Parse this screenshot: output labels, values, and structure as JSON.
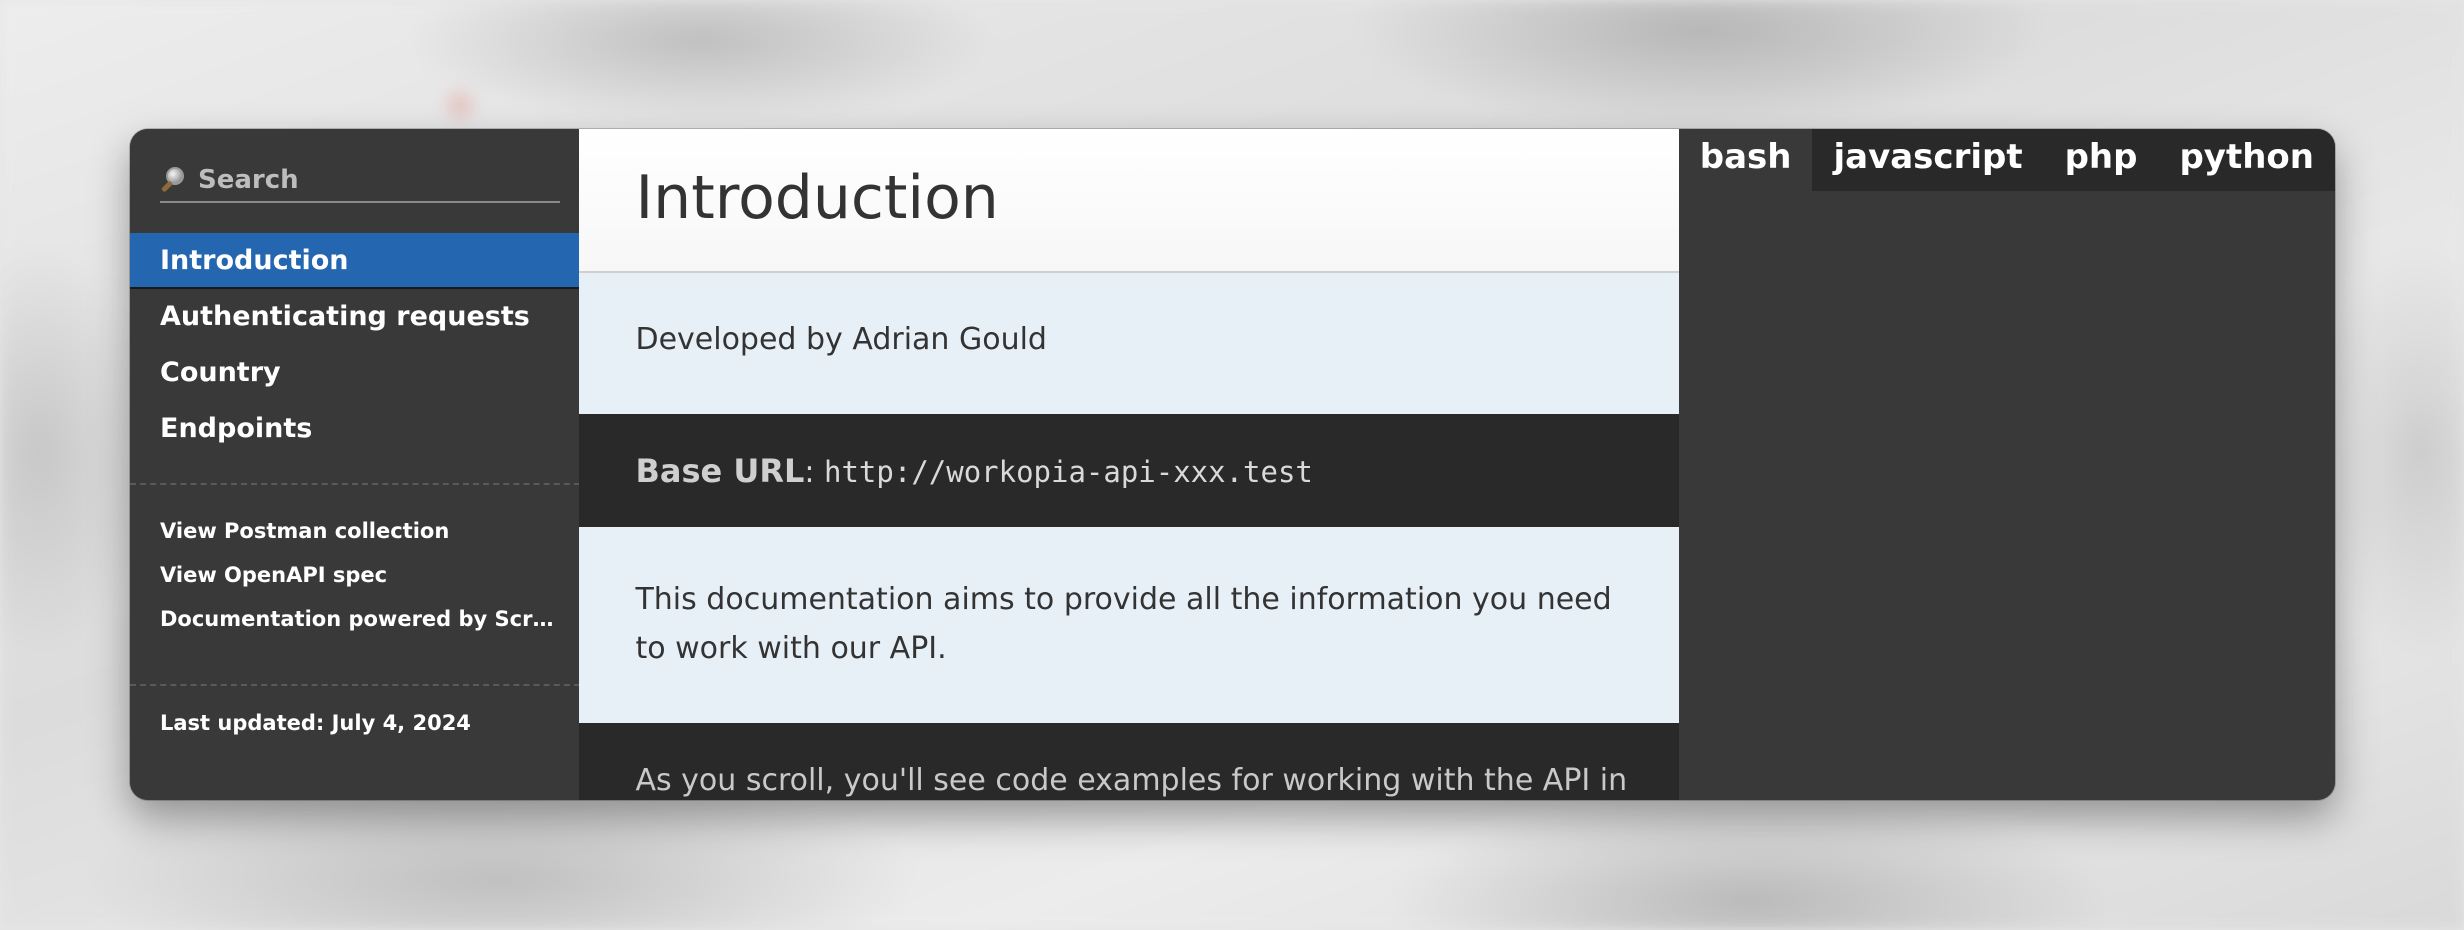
{
  "sidebar": {
    "search_placeholder": "Search",
    "nav_items": [
      {
        "label": "Introduction",
        "active": true
      },
      {
        "label": "Authenticating requests",
        "active": false
      },
      {
        "label": "Country",
        "active": false
      },
      {
        "label": "Endpoints",
        "active": false
      }
    ],
    "links": [
      {
        "label": "View Postman collection"
      },
      {
        "label": "View OpenAPI spec"
      },
      {
        "label": "Documentation powered by Scri…"
      }
    ],
    "last_updated": "Last updated: July 4, 2024"
  },
  "main": {
    "title": "Introduction",
    "developed_by": "Developed by Adrian Gould",
    "base_url_label": "Base URL",
    "base_url_sep": ": ",
    "base_url": "http://workopia-api-xxx.test",
    "intro_text": "This documentation aims to provide all the information you need to work with our API.",
    "scroll_text": "As you scroll, you'll see code examples for working with the API in"
  },
  "code_tabs": [
    {
      "label": "bash",
      "active": true
    },
    {
      "label": "javascript",
      "active": false
    },
    {
      "label": "php",
      "active": false
    },
    {
      "label": "python",
      "active": false
    }
  ],
  "colors": {
    "sidebar_bg": "#393939",
    "active_nav": "#2467b0",
    "light_block": "#e8f0f7",
    "dark_block": "#292929"
  },
  "icons": {
    "search": "search-icon"
  }
}
